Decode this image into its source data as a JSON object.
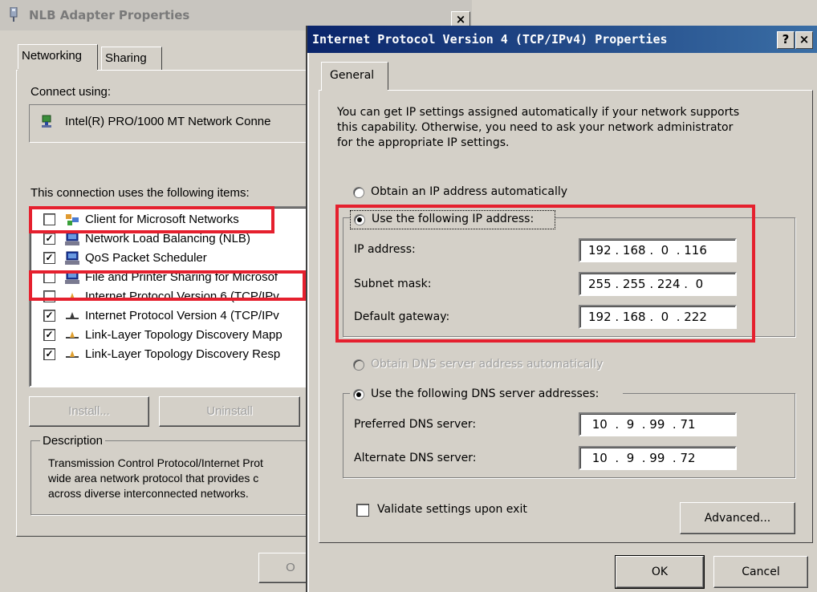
{
  "back_window": {
    "title": "NLB Adapter Properties",
    "close_glyph": "×",
    "tabs": [
      "Networking",
      "Sharing"
    ],
    "connect_using_label": "Connect using:",
    "adapter_name": "Intel(R) PRO/1000 MT Network Conne",
    "items_label": "This connection uses the following items:",
    "items": [
      {
        "label": "Client for Microsoft Networks",
        "checked": false,
        "icon": "client-network-icon"
      },
      {
        "label": "Network Load Balancing (NLB)",
        "checked": true,
        "icon": "network-service-icon"
      },
      {
        "label": "QoS Packet Scheduler",
        "checked": true,
        "icon": "network-service-icon"
      },
      {
        "label": "File and Printer Sharing for Microsof",
        "checked": false,
        "icon": "network-service-icon"
      },
      {
        "label": "Internet Protocol Version 6 (TCP/IPv",
        "checked": false,
        "icon": "protocol-icon"
      },
      {
        "label": "Internet Protocol Version 4 (TCP/IPv",
        "checked": true,
        "icon": "protocol-icon"
      },
      {
        "label": "Link-Layer Topology Discovery Mapp",
        "checked": true,
        "icon": "protocol-icon"
      },
      {
        "label": "Link-Layer Topology Discovery Resp",
        "checked": true,
        "icon": "protocol-icon"
      }
    ],
    "install_label": "Install...",
    "uninstall_label": "Uninstall",
    "description_label": "Description",
    "description_lines": [
      "Transmission Control Protocol/Internet Prot",
      "wide area network protocol that provides c",
      "across diverse interconnected networks."
    ],
    "ok_partial": "O"
  },
  "dialog": {
    "title": "Internet Protocol Version 4 (TCP/IPv4) Properties",
    "help_glyph": "?",
    "close_glyph": "×",
    "tab": "General",
    "intro_lines": [
      "You can get IP settings assigned automatically if your network supports",
      "this capability. Otherwise, you need to ask your network administrator",
      "for the appropriate IP settings."
    ],
    "obtain_ip_label": "Obtain an IP address automatically",
    "use_ip_label": "Use the following IP address:",
    "ip_address_label": "IP address:",
    "ip_address_value": "192 . 168 .  0  . 116",
    "subnet_label": "Subnet mask:",
    "subnet_value": "255 . 255 . 224 .  0",
    "gateway_label": "Default gateway:",
    "gateway_value": "192 . 168 .  0  . 222",
    "obtain_dns_label": "Obtain DNS server address automatically",
    "use_dns_label": "Use the following DNS server addresses:",
    "preferred_dns_label": "Preferred DNS server:",
    "preferred_dns_value": " 10  .  9  . 99  . 71",
    "alternate_dns_label": "Alternate DNS server:",
    "alternate_dns_value": " 10  .  9  . 99  . 72",
    "validate_label": "Validate settings upon exit",
    "advanced_label": "Advanced...",
    "ok_label": "OK",
    "cancel_label": "Cancel"
  },
  "colors": {
    "highlight": "#e5202e",
    "title_active": "#0a246a",
    "face": "#d4d0c8"
  }
}
